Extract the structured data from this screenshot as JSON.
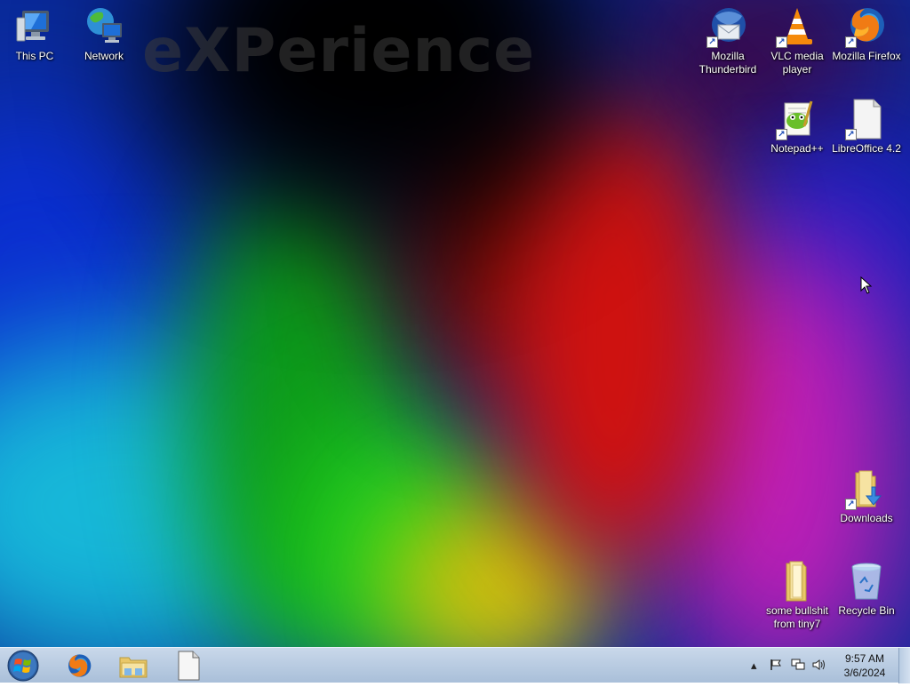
{
  "desktop": {
    "watermark": "eXPerience",
    "icons": [
      {
        "label": "This PC",
        "icon": "computer-icon"
      },
      {
        "label": "Network",
        "icon": "network-icon"
      },
      {
        "label": "Mozilla Thunderbird",
        "icon": "thunderbird-icon",
        "shortcut": true
      },
      {
        "label": "VLC media player",
        "icon": "vlc-icon",
        "shortcut": true
      },
      {
        "label": "Mozilla Firefox",
        "icon": "firefox-icon",
        "shortcut": true
      },
      {
        "label": "Notepad++",
        "icon": "notepadpp-icon",
        "shortcut": true
      },
      {
        "label": "LibreOffice 4.2",
        "icon": "libreoffice-icon",
        "shortcut": true
      },
      {
        "label": "Downloads",
        "icon": "downloads-folder-icon",
        "shortcut": true
      },
      {
        "label": "some bullshit from tiny7",
        "icon": "folder-icon"
      },
      {
        "label": "Recycle Bin",
        "icon": "recycle-bin-icon"
      }
    ]
  },
  "taskbar": {
    "start_icon": "windows-orb-icon",
    "pinned": [
      {
        "name": "Mozilla Firefox",
        "icon": "firefox-icon"
      },
      {
        "name": "File Explorer",
        "icon": "file-explorer-icon"
      },
      {
        "name": "LibreOffice",
        "icon": "libreoffice-icon"
      }
    ],
    "tray_icons": [
      "show-hidden-icons-arrow",
      "action-center-flag-icon",
      "network-tray-icon",
      "volume-icon"
    ],
    "clock": {
      "time": "9:57 AM",
      "date": "3/6/2024"
    }
  }
}
